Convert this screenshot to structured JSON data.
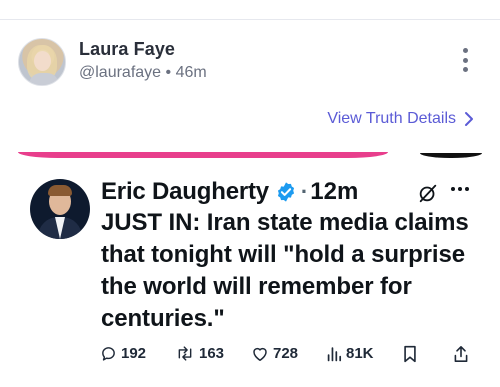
{
  "post": {
    "author_name": "Laura Faye",
    "handle": "@laurafaye",
    "separator": "•",
    "age": "46m",
    "details_link": "View Truth Details"
  },
  "tweet": {
    "author_name": "Eric Daugherty",
    "separator": "·",
    "time": "12m",
    "text": "JUST IN: Iran state media claims that tonight will \"hold a surprise the world will remember for centuries.\"",
    "actions": {
      "replies": "192",
      "reposts": "163",
      "likes": "728",
      "views": "81K"
    }
  },
  "colors": {
    "link": "#5b5bd6",
    "pink_bar": "#e83e8c",
    "verified": "#1d9bf0"
  },
  "icons": [
    "kebab-menu-icon",
    "chevron-right-icon",
    "verified-badge-icon",
    "grok-icon",
    "more-icon",
    "reply-icon",
    "repost-icon",
    "like-icon",
    "views-icon",
    "bookmark-icon",
    "share-icon"
  ]
}
